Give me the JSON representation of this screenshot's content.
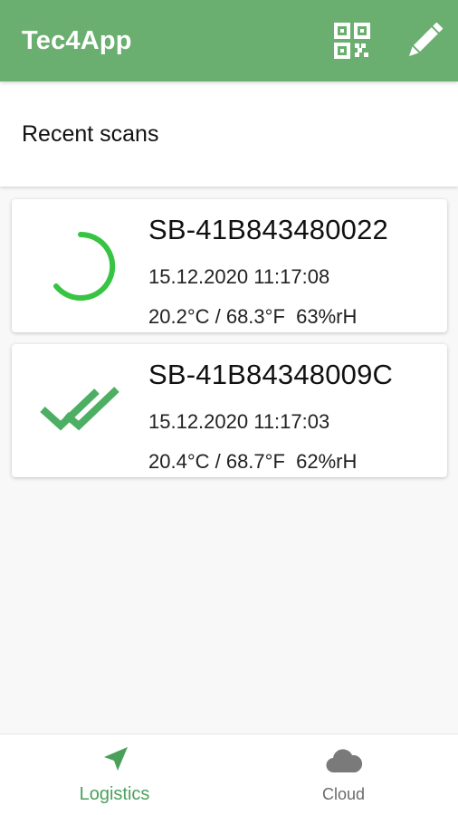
{
  "app": {
    "title": "Tec4App"
  },
  "colors": {
    "primary": "#6aaf6f",
    "accent_green": "#37c443",
    "check_green": "#4caf63",
    "inactive": "#7a7a7a"
  },
  "toolbar": {
    "actions": [
      {
        "icon": "qr-code-icon"
      },
      {
        "icon": "edit-pencil-icon"
      }
    ]
  },
  "section": {
    "title": "Recent scans"
  },
  "scans": [
    {
      "id": "SB-41B843480022",
      "timestamp": "15.12.2020 11:17:08",
      "environment": "20.2°C / 68.3°F  63%rH",
      "status_icon": "progress-spinner-icon"
    },
    {
      "id": "SB-41B84348009C",
      "timestamp": "15.12.2020 11:17:03",
      "environment": "20.4°C / 68.7°F  62%rH",
      "status_icon": "double-check-icon"
    }
  ],
  "bottom_nav": [
    {
      "label": "Logistics",
      "icon": "navigation-arrow-icon",
      "active": true
    },
    {
      "label": "Cloud",
      "icon": "cloud-icon",
      "active": false
    }
  ]
}
